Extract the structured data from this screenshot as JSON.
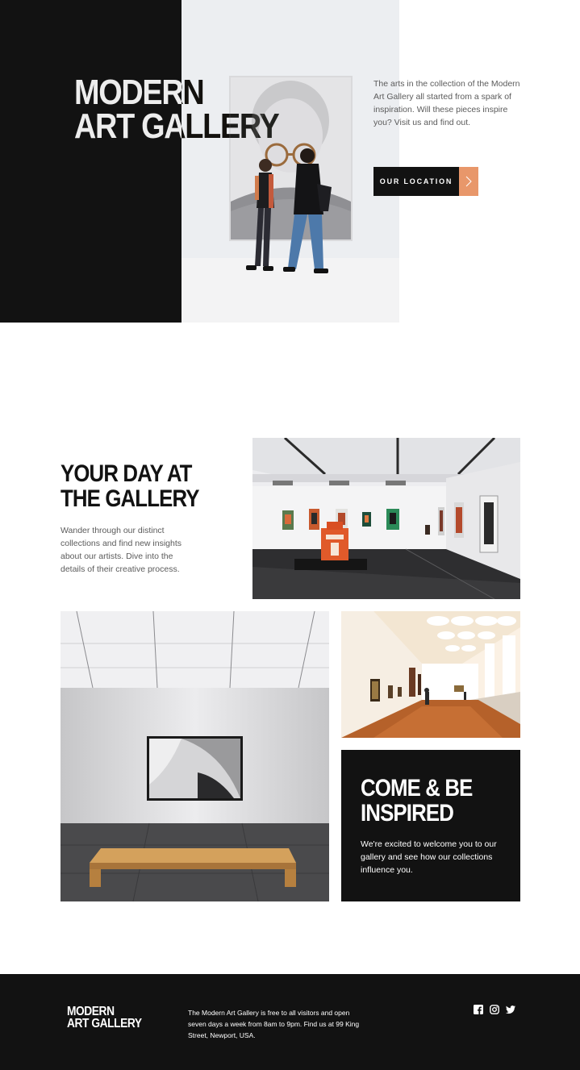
{
  "hero": {
    "title_line1": "MODERN",
    "title_line2": "ART GALLERY",
    "description": "The arts in the collection of the Modern Art Gallery all started from a spark of inspiration. Will these pieces inspire you? Visit us and find out.",
    "cta_label": "OUR LOCATION",
    "cta_icon": "chevron-right-icon",
    "accent_color": "#e8976a"
  },
  "day_section": {
    "title_line1": "YOUR DAY AT",
    "title_line2": "THE GALLERY",
    "description": "Wander through our distinct collections and find new insights about our artists. Dive into the details of their creative process."
  },
  "inspired_section": {
    "title_line1": "COME & BE",
    "title_line2": "INSPIRED",
    "description": "We're excited to welcome you to our gallery and see how our collections influence you."
  },
  "footer": {
    "logo_line1": "MODERN",
    "logo_line2": "ART GALLERY",
    "info": "The Modern Art Gallery is free to all visitors and open seven days a week from 8am to 9pm. Find us at 99 King Street, Newport, USA.",
    "social": [
      "facebook-icon",
      "instagram-icon",
      "twitter-icon"
    ]
  },
  "colors": {
    "dark": "#121212",
    "text_gray": "#5b5b5b",
    "white": "#ffffff"
  }
}
